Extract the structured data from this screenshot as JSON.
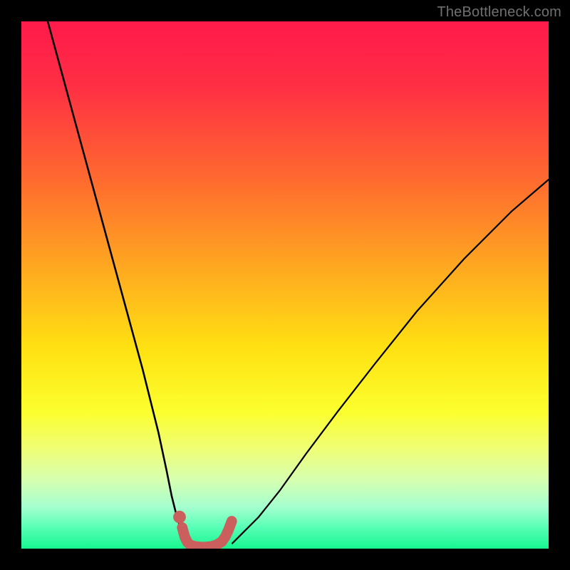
{
  "watermark": {
    "text": "TheBottleneck.com"
  },
  "chart_data": {
    "type": "line",
    "title": "",
    "xlabel": "",
    "ylabel": "",
    "xlim": [
      0,
      100
    ],
    "ylim": [
      0,
      100
    ],
    "grid": false,
    "legend": false,
    "gradient_stops": [
      {
        "pct": 0,
        "color": "#ff1a4b"
      },
      {
        "pct": 12,
        "color": "#ff2e44"
      },
      {
        "pct": 30,
        "color": "#ff6a2f"
      },
      {
        "pct": 48,
        "color": "#ffad1f"
      },
      {
        "pct": 62,
        "color": "#ffe112"
      },
      {
        "pct": 74,
        "color": "#fcff2e"
      },
      {
        "pct": 81,
        "color": "#effe75"
      },
      {
        "pct": 87,
        "color": "#d6ffb0"
      },
      {
        "pct": 92,
        "color": "#a6ffcf"
      },
      {
        "pct": 96,
        "color": "#57ffb6"
      },
      {
        "pct": 100,
        "color": "#17f58f"
      }
    ],
    "series": [
      {
        "name": "left-branch",
        "style": "black-thin",
        "x": [
          5,
          8,
          11,
          14,
          17,
          20,
          23,
          26,
          27.5,
          28.5,
          29.5,
          30.5,
          31.5
        ],
        "y": [
          100,
          89,
          78,
          67,
          56,
          45,
          34,
          22,
          15,
          10,
          6,
          3,
          1
        ]
      },
      {
        "name": "right-branch",
        "style": "black-thin",
        "x": [
          40,
          42,
          45,
          49,
          54,
          60,
          67,
          75,
          84,
          93,
          100
        ],
        "y": [
          1,
          3,
          6,
          11,
          18,
          26,
          35,
          45,
          55,
          64,
          70
        ]
      },
      {
        "name": "trough-marker",
        "style": "salmon-thick",
        "x": [
          30.5,
          31,
          31.5,
          32,
          33,
          34,
          35,
          36,
          37,
          38,
          38.7,
          39.3,
          39.9
        ],
        "y": [
          4,
          2.2,
          1.2,
          0.7,
          0.4,
          0.3,
          0.3,
          0.4,
          0.7,
          1.3,
          2.3,
          3.6,
          5.2
        ]
      }
    ],
    "marker_dot": {
      "x": 30,
      "y": 6,
      "color": "#cb5f5e",
      "r": 1.2
    }
  }
}
